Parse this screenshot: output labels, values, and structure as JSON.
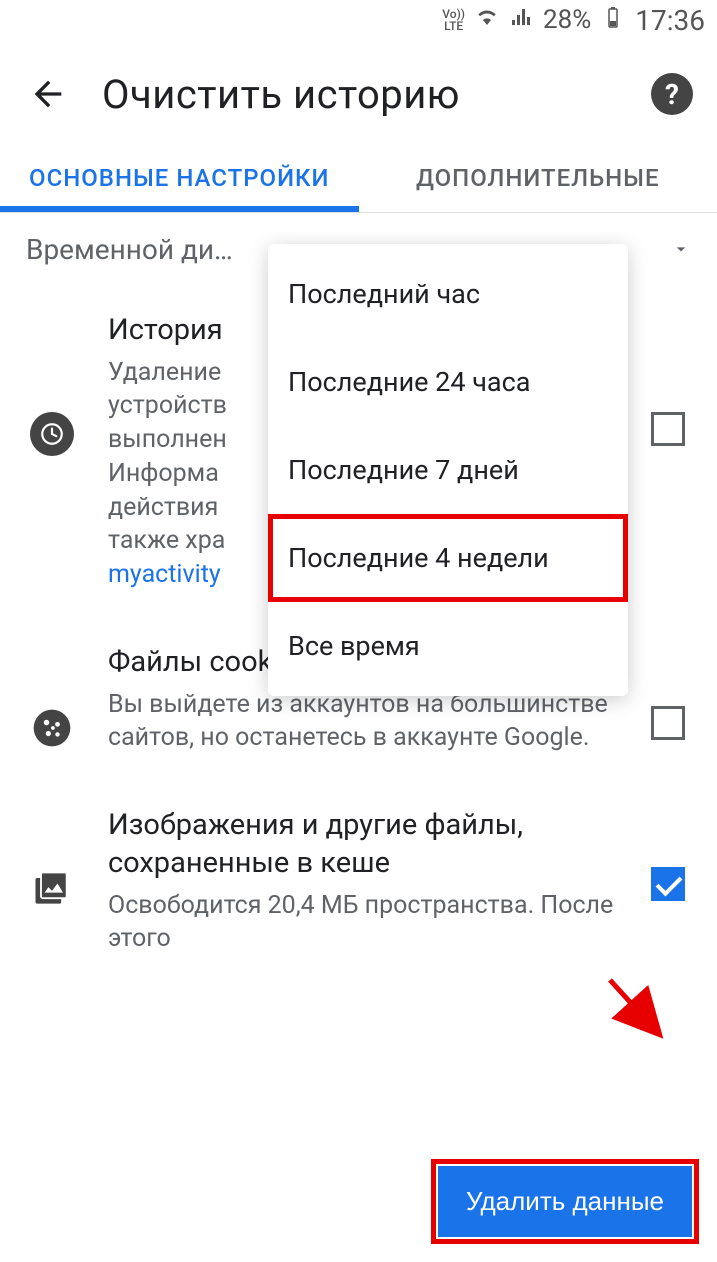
{
  "status_bar": {
    "volte": "Vo))\nLTE",
    "battery_pct": "28%",
    "time": "17:36"
  },
  "header": {
    "title": "Очистить историю",
    "help": "?"
  },
  "tabs": {
    "basic": "ОСНОВНЫЕ НАСТРОЙКИ",
    "advanced": "ДОПОЛНИТЕЛЬНЫЕ"
  },
  "timerange": {
    "label": "Временной ди…",
    "options": [
      "Последний час",
      "Последние 24 часа",
      "Последние 7 дней",
      "Последние 4 недели",
      "Все время"
    ]
  },
  "settings": {
    "history": {
      "title": "История",
      "desc_prefix": "Удаление\nустройств\nвыполнен\nИнформа\nдействия\nтакже хра",
      "link": "myactivity",
      "checked": false
    },
    "cookies": {
      "title": "Файлы cookie и данные сайтов",
      "desc": "Вы выйдете из аккаунтов на большинстве сайтов, но останетесь в аккаунте Google.",
      "checked": false
    },
    "cache": {
      "title": "Изображения и другие файлы, сохраненные в кеше",
      "desc": "Освободится 20,4 МБ пространства. После этого",
      "checked": true
    }
  },
  "action": {
    "label": "Удалить данные"
  }
}
